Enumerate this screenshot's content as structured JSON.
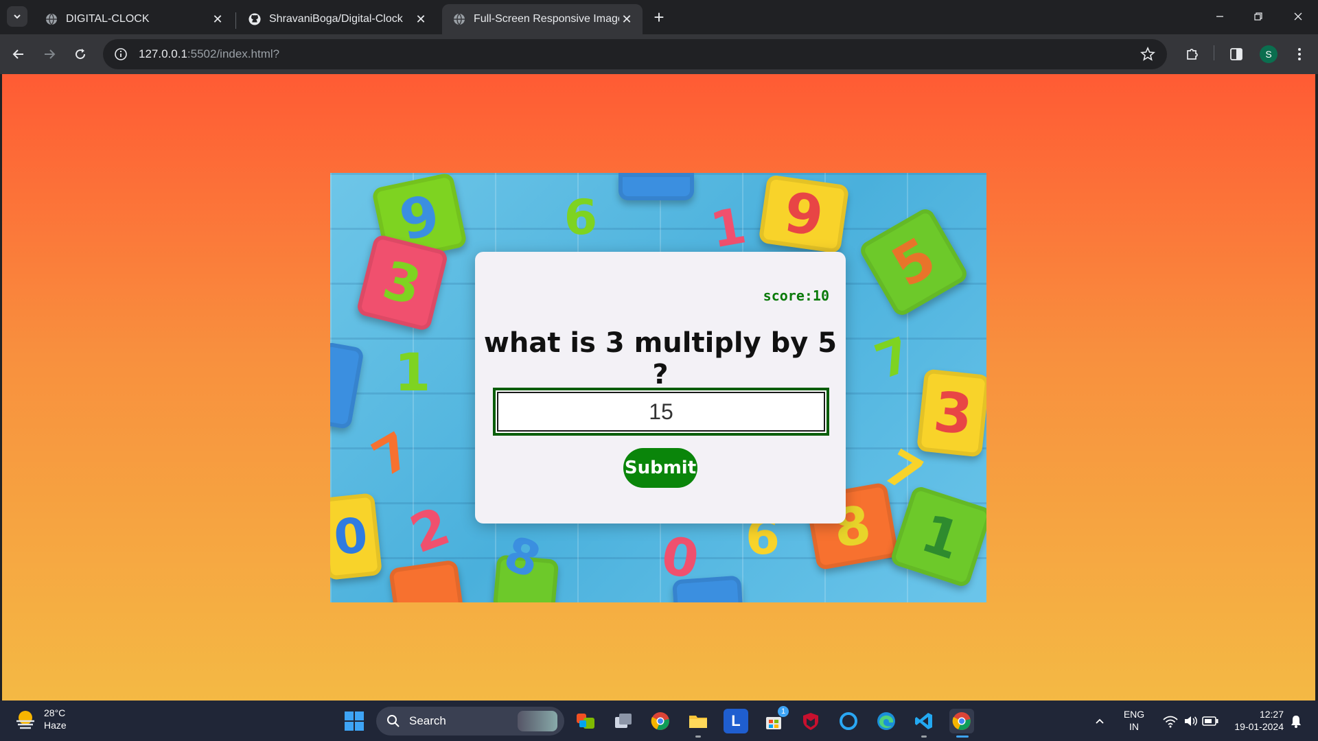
{
  "browser": {
    "tabs": [
      {
        "title": "DIGITAL-CLOCK",
        "icon": "globe-icon",
        "active": false
      },
      {
        "title": "ShravaniBoga/Digital-Clock",
        "icon": "github-icon",
        "active": false
      },
      {
        "title": "Full-Screen Responsive Image",
        "icon": "globe-icon",
        "active": true
      }
    ],
    "url_host": "127.0.0.1",
    "url_path": ":5502/index.html?",
    "profile_initial": "S"
  },
  "page": {
    "score_label": "score:10",
    "question": "what is 3 multiply by 5 ?",
    "answer_value": "15",
    "submit_label": "Submit",
    "background_colors": {
      "top": "#ff5b34",
      "bottom": "#f4b944"
    },
    "card_accent": "#0a850a"
  },
  "taskbar": {
    "weather_temp": "28°C",
    "weather_desc": "Haze",
    "search_label": "Search",
    "language_top": "ENG",
    "language_bottom": "IN",
    "time": "12:27",
    "date": "19-01-2024",
    "store_badge": "1"
  }
}
